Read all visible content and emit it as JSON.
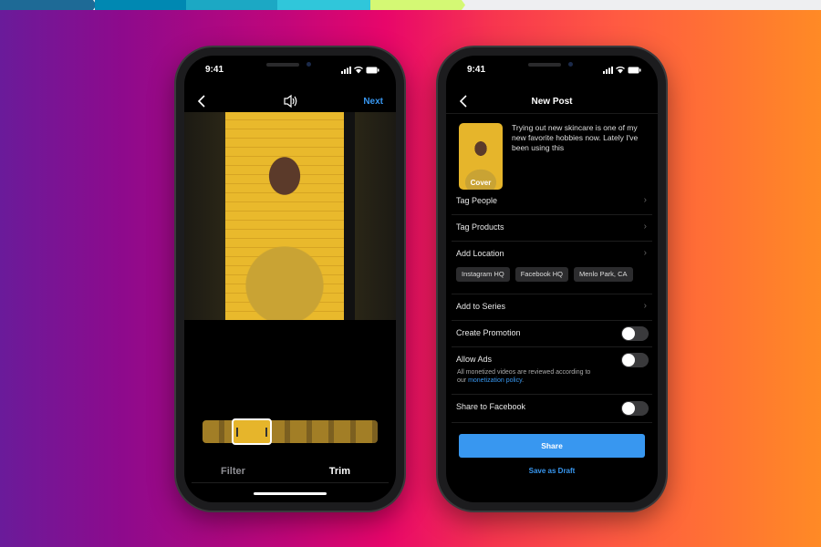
{
  "progress_bar": {
    "segments": [
      "#1e6a96",
      "#0088b2",
      "#1ca8c4",
      "#30c6da",
      "#d4f874"
    ]
  },
  "left_phone": {
    "status": {
      "time": "9:41"
    },
    "nav": {
      "back_icon": "chevron-left-icon",
      "sound_icon": "speaker-icon",
      "next_label": "Next"
    },
    "tabs": {
      "filter": "Filter",
      "trim": "Trim"
    }
  },
  "right_phone": {
    "status": {
      "time": "9:41"
    },
    "nav": {
      "title": "New Post"
    },
    "post": {
      "cover_label": "Cover",
      "caption": "Trying out new skincare is one of my new favorite hobbies now. Lately I've been using this"
    },
    "rows": {
      "tag_people": "Tag People",
      "tag_products": "Tag Products",
      "add_location": "Add Location",
      "location_chips": [
        "Instagram HQ",
        "Facebook HQ",
        "Menlo Park, CA"
      ],
      "add_to_series": "Add to Series",
      "create_promotion": "Create Promotion",
      "allow_ads": "Allow Ads",
      "allow_ads_sub_prefix": "All monetized videos are reviewed according to our ",
      "allow_ads_sub_link": "monetization policy",
      "allow_ads_sub_suffix": ".",
      "share_to_facebook": "Share to Facebook"
    },
    "toggles": {
      "create_promotion": false,
      "allow_ads": false,
      "share_to_facebook": false
    },
    "share_label": "Share",
    "draft_label": "Save as Draft"
  },
  "colors": {
    "accent": "#3897f0"
  }
}
